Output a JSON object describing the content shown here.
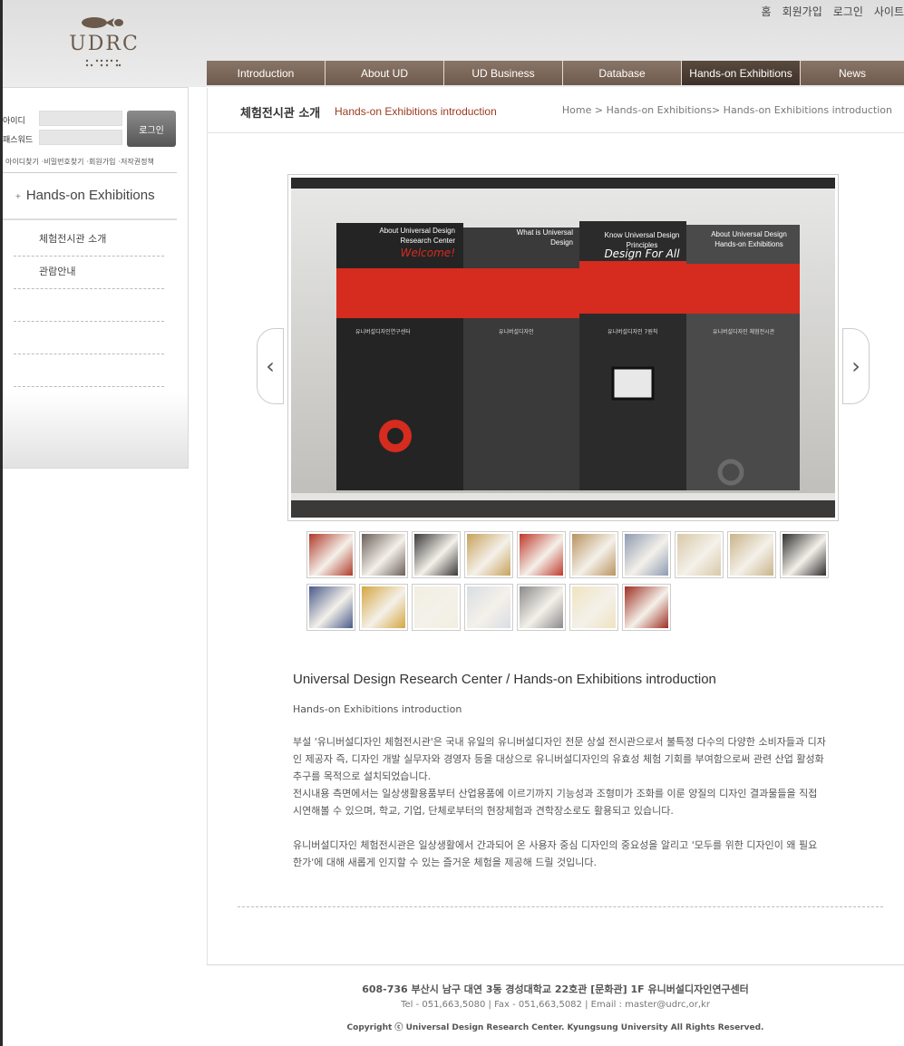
{
  "header": {
    "logo_text": "UDRC",
    "top_links": [
      "홈",
      "회원가입",
      "로그인",
      "사이트"
    ]
  },
  "nav": {
    "items": [
      {
        "label": "Introduction"
      },
      {
        "label": "About UD"
      },
      {
        "label": "UD Business"
      },
      {
        "label": "Database"
      },
      {
        "label": "Hands-on Exhibitions",
        "active": true
      },
      {
        "label": "News"
      }
    ]
  },
  "sidebar": {
    "id_label": "아이디",
    "pw_label": "패스워드",
    "login_button": "로그인",
    "sub_links": [
      "아이디찾기",
      "·비밀번호찾기",
      "·회원가입",
      "·저작권정책"
    ],
    "title_plus": "+",
    "title": "Hands-on Exhibitions",
    "menu": [
      "체험전시관 소개",
      "관람안내",
      "",
      "",
      ""
    ]
  },
  "content": {
    "title": "체험전시관 소개",
    "subtitle": "Hands-on Exhibitions introduction",
    "breadcrumb": "Home > Hands-on Exhibitions> Hands-on Exhibitions introduction"
  },
  "gallery": {
    "panels": [
      {
        "heading": "About Universal Design Research Center",
        "accent": "Welcome!",
        "body": "유니버설디자인연구센터"
      },
      {
        "heading": "What is Universal Design",
        "accent": "",
        "body": "유니버설디자인"
      },
      {
        "heading": "Know Universal Design Principles",
        "accent": "Design For All",
        "body": "유니버설디자인 7원칙"
      },
      {
        "heading": "About Universal Design Hands-on Exhibitions",
        "accent": "",
        "body": "유니버설디자인 체험전시관"
      }
    ],
    "thumb_colors": [
      "#b03a2a",
      "#6a5f58",
      "#3a3a3a",
      "#c7a15a",
      "#c0392b",
      "#b9935e",
      "#8e9bb2",
      "#d8c9a8",
      "#c9b48a",
      "#2e2e2e",
      "#4a5a8a",
      "#d4a640",
      "#f2eee0",
      "#d9dde3",
      "#8a8a8a",
      "#efe3c0",
      "#9e2f22"
    ]
  },
  "text": {
    "heading": "Universal Design Research Center / Hands-on Exhibitions introduction",
    "sub": "Hands-on Exhibitions introduction",
    "para1": "부설 '유니버설디자인 체험전시관'은 국내 유일의 유니버설디자인 전문 상설 전시관으로서 불특정 다수의 다양한 소비자들과 디자인 제공자 즉, 디자인 개발 실무자와 경영자 등을 대상으로 유니버설디자인의 유효성 체험 기회를 부여함으로써 관련 산업 활성화 추구를 목적으로 설치되었습니다.",
    "para2": "전시내용 측면에서는 일상생활용품부터 산업용품에 이르기까지 기능성과 조형미가 조화를 이룬 양질의 디자인 결과물들을 직접 시연해볼 수 있으며, 학교, 기업, 단체로부터의 현장체험과 견학장소로도 활용되고 있습니다.",
    "para3": "유니버설디자인 체험전시관은 일상생활에서 간과되어 온 사용자 중심 디자인의 중요성을 알리고 '모두를 위한 디자인이 왜 필요한가'에 대해 새롭게 인지할 수 있는 즐거운 체험을 제공해 드릴 것입니다."
  },
  "footer": {
    "address": "608-736 부산시 남구 대연 3동 경성대학교 22호관 [문화관] 1F 유니버설디자인연구센터",
    "tel": "Tel - 051,663,5080 | Fax - 051,663,5082 | Email : master@udrc,or,kr",
    "copyright": "Copyright ⓒ Universal Design Research Center. Kyungsung University All Rights Reserved."
  },
  "colors": {
    "nav_brown": "#7d695b",
    "nav_active": "#4a3b31",
    "accent_red": "#9b3a20",
    "panel_red": "#d62b1f"
  }
}
